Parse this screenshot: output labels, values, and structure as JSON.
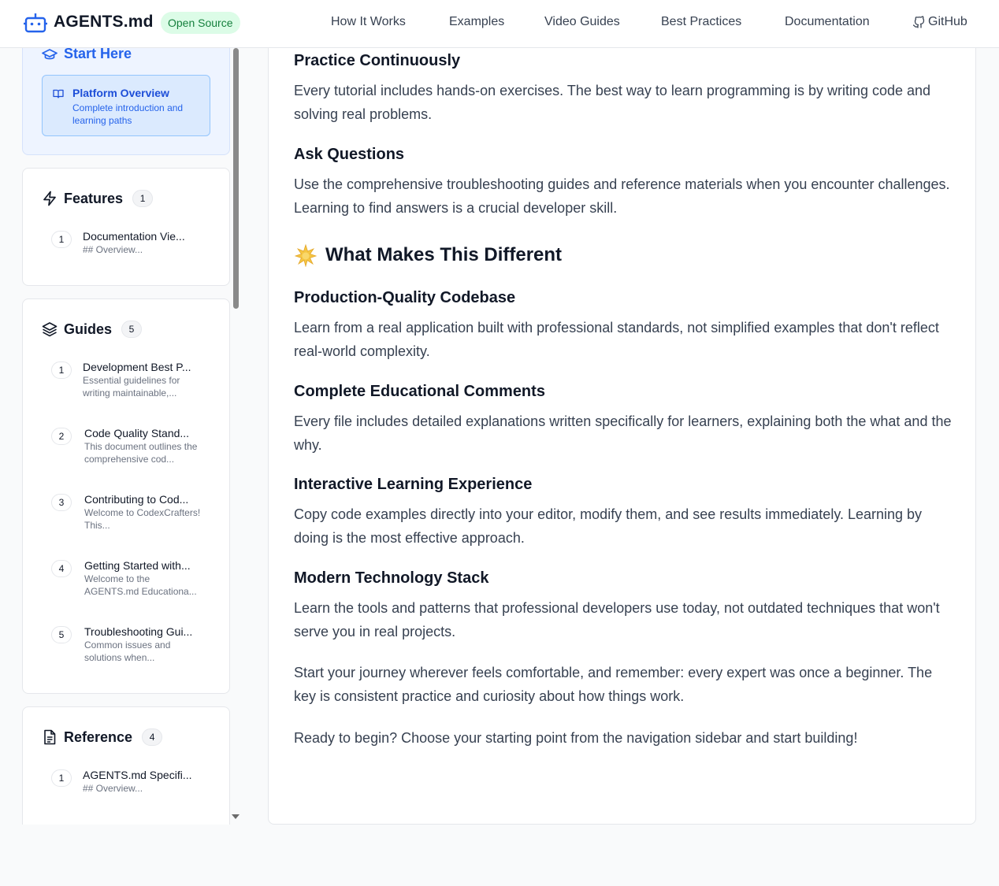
{
  "header": {
    "brand": "AGENTS.md",
    "badge": "Open Source",
    "nav": [
      "How It Works",
      "Examples",
      "Video Guides",
      "Best Practices",
      "Documentation",
      "GitHub"
    ]
  },
  "sidebar": {
    "start": {
      "title": "Start Here",
      "item_title": "Platform Overview",
      "item_desc": "Complete introduction and learning paths"
    },
    "features": {
      "title": "Features",
      "count": "1",
      "items": [
        {
          "num": "1",
          "title": "Documentation Vie...",
          "desc": "## Overview..."
        }
      ]
    },
    "guides": {
      "title": "Guides",
      "count": "5",
      "items": [
        {
          "num": "1",
          "title": "Development Best P...",
          "desc": "Essential guidelines for writing maintainable,..."
        },
        {
          "num": "2",
          "title": "Code Quality Stand...",
          "desc": "This document outlines the comprehensive cod..."
        },
        {
          "num": "3",
          "title": "Contributing to Cod...",
          "desc": "Welcome to CodexCrafters! This..."
        },
        {
          "num": "4",
          "title": "Getting Started with...",
          "desc": "Welcome to the AGENTS.md Educationa..."
        },
        {
          "num": "5",
          "title": "Troubleshooting Gui...",
          "desc": "Common issues and solutions when..."
        }
      ]
    },
    "reference": {
      "title": "Reference",
      "count": "4",
      "items": [
        {
          "num": "1",
          "title": "AGENTS.md Specifi...",
          "desc": "## Overview..."
        }
      ]
    }
  },
  "content": {
    "practice_title": "Practice Continuously",
    "practice_text": "Every tutorial includes hands-on exercises. The best way to learn programming is by writing code and solving real problems.",
    "ask_title": "Ask Questions",
    "ask_text": "Use the comprehensive troubleshooting guides and reference materials when you encounter challenges. Learning to find answers is a crucial developer skill.",
    "different_title": "What Makes This Different",
    "prod_title": "Production-Quality Codebase",
    "prod_text": "Learn from a real application built with professional standards, not simplified examples that don't reflect real-world complexity.",
    "comments_title": "Complete Educational Comments",
    "comments_text": "Every file includes detailed explanations written specifically for learners, explaining both the what and the why.",
    "interactive_title": "Interactive Learning Experience",
    "interactive_text": "Copy code examples directly into your editor, modify them, and see results immediately. Learning by doing is the most effective approach.",
    "modern_title": "Modern Technology Stack",
    "modern_text": "Learn the tools and patterns that professional developers use today, not outdated techniques that won't serve you in real projects.",
    "journey_text": "Start your journey wherever feels comfortable, and remember: every expert was once a beginner. The key is consistent practice and curiosity about how things work.",
    "ready_text": "Ready to begin? Choose your starting point from the navigation sidebar and start building!"
  }
}
